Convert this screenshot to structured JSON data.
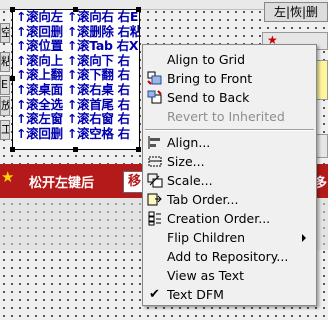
{
  "top": {
    "right_label": "左|恢|删",
    "left_buttons": [
      "空",
      "粘",
      "E",
      "放",
      "工"
    ]
  },
  "memo_lines": [
    "↑滚向左 ↑滚向右 右En",
    "↑滚回删 ↑滚删除 右粘",
    "↑滚位置 ↑滚Tab 右X",
    "↑滚向上 ↑滚向下 右",
    "↑滚上翻 ↑滚下翻 右",
    "↑滚桌面 ↑滚右桌 右",
    "↑滚全选 ↑滚首尾 右",
    "↑滚左窗 ↑滚右窗 右",
    "↑滚回删 ↑滚空格 右"
  ],
  "right_partial": [
    "",
    "",
    "",
    "",
    "",
    "",
    "",
    "",
    ""
  ],
  "banner": {
    "text": "松开左键后",
    "button": "移",
    "right_text": "移"
  },
  "menu": {
    "items": [
      {
        "label": "Align to Grid",
        "icon": "align-grid-icon"
      },
      {
        "label": "Bring to Front",
        "icon": "bring-to-front-icon"
      },
      {
        "label": "Send to Back",
        "icon": "send-to-back-icon"
      },
      {
        "label": "Revert to Inherited",
        "icon": "",
        "disabled": true
      },
      {
        "label": "Align...",
        "icon": "align-icon"
      },
      {
        "label": "Size...",
        "icon": "size-icon"
      },
      {
        "label": "Scale...",
        "icon": "scale-icon"
      },
      {
        "label": "Tab Order...",
        "icon": "tab-order-icon"
      },
      {
        "label": "Creation Order...",
        "icon": "creation-order-icon"
      },
      {
        "label": "Flip Children",
        "icon": "",
        "submenu": true
      },
      {
        "label": "Add to Repository...",
        "icon": ""
      },
      {
        "label": "View as Text",
        "icon": ""
      },
      {
        "label": "Text DFM",
        "icon": "",
        "checked": true
      }
    ]
  }
}
